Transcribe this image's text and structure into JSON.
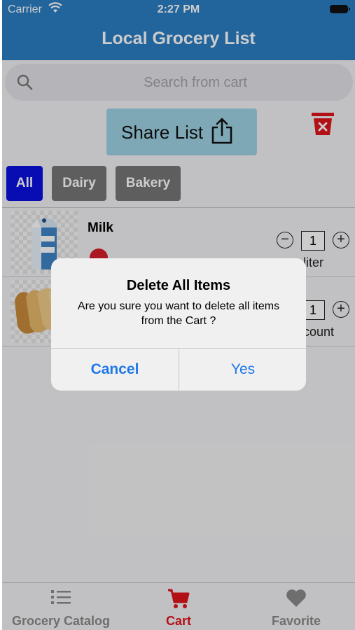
{
  "status_bar": {
    "carrier": "Carrier",
    "time": "2:27 PM"
  },
  "nav": {
    "title": "Local Grocery List"
  },
  "search": {
    "placeholder": "Search from cart"
  },
  "share": {
    "label": "Share List"
  },
  "filters": [
    "All",
    "Dairy",
    "Bakery"
  ],
  "items": [
    {
      "name": "Milk",
      "quantity": "1",
      "unit": "liter",
      "thumb_icon": "milk-carton-icon"
    },
    {
      "name": "",
      "quantity": "1",
      "unit": "count",
      "thumb_icon": "bread-icon"
    }
  ],
  "alert": {
    "title": "Delete All Items",
    "message": "Are you sure you want to delete all items from the Cart ?",
    "cancel": "Cancel",
    "confirm": "Yes"
  },
  "tabs": [
    {
      "label": "Grocery Catalog",
      "icon": "list-icon"
    },
    {
      "label": "Cart",
      "icon": "cart-icon"
    },
    {
      "label": "Favorite",
      "icon": "heart-icon"
    }
  ],
  "colors": {
    "nav_bar": "#2b7ec3",
    "share_button": "#9fd3e5",
    "filter_selected": "#0b10e0",
    "filter_default": "#767676",
    "delete_red": "#e0141c",
    "alert_button_text": "#1f78e8"
  }
}
